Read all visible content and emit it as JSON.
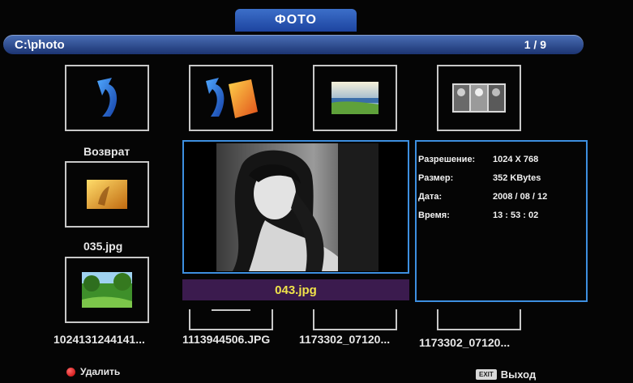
{
  "header": {
    "title": "ФОТО"
  },
  "pathbar": {
    "path": "C:\\photo",
    "page": "1 / 9"
  },
  "grid": {
    "back_label": "Возврат",
    "item_035": "035.jpg",
    "item_1024": "1024131244141...",
    "item_1113": "1113944506.JPG",
    "item_1173a": "1173302_07120...",
    "item_1173b": "1173302_07120..."
  },
  "preview": {
    "filename": "043.jpg"
  },
  "info": {
    "rows": [
      {
        "key": "Разрешение:",
        "value": "1024 X 768"
      },
      {
        "key": "Размер:",
        "value": "352 KBytes"
      },
      {
        "key": "Дата:",
        "value": "2008 / 08 / 12"
      },
      {
        "key": "Время:",
        "value": "13 : 53 : 02"
      }
    ]
  },
  "footer": {
    "delete_label": "Удалить",
    "exit_key": "EXIT",
    "exit_label": "Выход"
  },
  "colors": {
    "accent": "#3d8fe0",
    "title_bar": "#2a56b3",
    "name_bar": "#3b1b4e",
    "name_text": "#f0e34a"
  }
}
